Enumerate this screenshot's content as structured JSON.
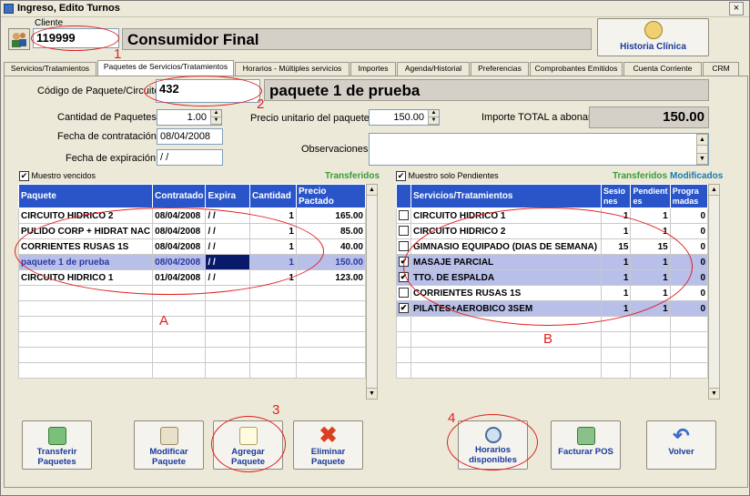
{
  "window": {
    "title": "Ingreso, Edito Turnos",
    "close": "×"
  },
  "cliente": {
    "label": "Cliente",
    "code": "119999",
    "name": "Consumidor Final",
    "historia_button": "Historia Clínica"
  },
  "tabs": [
    "Servicios/Tratamientos",
    "Paquetes de Servicios/Tratamientos",
    "Horarios - Múltiples servicios",
    "Importes",
    "Agenda/Historial",
    "Preferencias",
    "Comprobantes Emitidos",
    "Cuenta Corriente",
    "CRM"
  ],
  "form": {
    "codigo_label": "Código de Paquete/Circuito",
    "codigo_value": "432",
    "paquete_name": "paquete 1 de prueba",
    "cantidad_label": "Cantidad de Paquetes",
    "cantidad_value": "1.00",
    "precio_label": "Precio unitario del paquete",
    "precio_value": "150.00",
    "importe_label": "Importe TOTAL a abonar",
    "importe_value": "150.00",
    "fecha_contratacion_label": "Fecha de contratación",
    "fecha_contratacion_value": "08/04/2008",
    "fecha_expiracion_label": "Fecha de expiración",
    "fecha_expiracion_value": " / /",
    "observaciones_label": "Observaciones",
    "observaciones_value": ""
  },
  "left_grid": {
    "checkbox_label": "Muestro vencidos",
    "legend": "Transferidos",
    "headers": [
      "Paquete",
      "Contratado",
      "Expira",
      "Cantidad",
      "Precio Pactado"
    ],
    "rows": [
      [
        "CIRCUITO HIDRICO 2",
        "08/04/2008",
        " / /",
        "1",
        "165.00"
      ],
      [
        "PULIDO CORP + HIDRAT NAC",
        "08/04/2008",
        " / /",
        "1",
        "85.00"
      ],
      [
        "CORRIENTES RUSAS 1S",
        "08/04/2008",
        " / /",
        "1",
        "40.00"
      ],
      [
        "paquete 1 de prueba",
        "08/04/2008",
        " / /",
        "1",
        "150.00"
      ],
      [
        "CIRCUITO HIDRICO 1",
        "01/04/2008",
        " / /",
        "1",
        "123.00"
      ]
    ],
    "selected_row": 3
  },
  "right_grid": {
    "checkbox_label": "Muestro solo Pendientes",
    "legend_transferidos": "Transferidos",
    "legend_modificados": "Modificados",
    "headers": [
      "Servicios/Tratamientos",
      "Sesiones",
      "Pendientes",
      "Programadas"
    ],
    "rows": [
      {
        "checked": false,
        "name": "CIRCUITO HIDRICO 1",
        "ses": "1",
        "pen": "1",
        "prog": "0"
      },
      {
        "checked": false,
        "name": "CIRCUITO HIDRICO 2",
        "ses": "1",
        "pen": "1",
        "prog": "0"
      },
      {
        "checked": false,
        "name": "GIMNASIO EQUIPADO (DIAS DE SEMANA)",
        "ses": "15",
        "pen": "15",
        "prog": "0"
      },
      {
        "checked": true,
        "name": "MASAJE PARCIAL",
        "ses": "1",
        "pen": "1",
        "prog": "0"
      },
      {
        "checked": true,
        "name": "TTO. DE ESPALDA",
        "ses": "1",
        "pen": "1",
        "prog": "0"
      },
      {
        "checked": false,
        "name": "CORRIENTES RUSAS 1S",
        "ses": "1",
        "pen": "1",
        "prog": "0"
      },
      {
        "checked": true,
        "name": "PILATES+AEROBICO 3SEM",
        "ses": "1",
        "pen": "1",
        "prog": "0"
      }
    ]
  },
  "buttons": {
    "transferir": "Transferir Paquetes",
    "modificar": "Modificar Paquete",
    "agregar": "Agregar Paquete",
    "eliminar": "Eliminar Paquete",
    "horarios": "Horarios disponibles",
    "facturar": "Facturar POS",
    "volver": "Volver"
  },
  "annotations": {
    "n1": "1",
    "n2": "2",
    "n3": "3",
    "n4": "4",
    "a": "A",
    "b": "B"
  },
  "colors": {
    "header_blue": "#2a55c8",
    "selected_row": "#b8bfe8",
    "annotation_red": "#e02020"
  }
}
